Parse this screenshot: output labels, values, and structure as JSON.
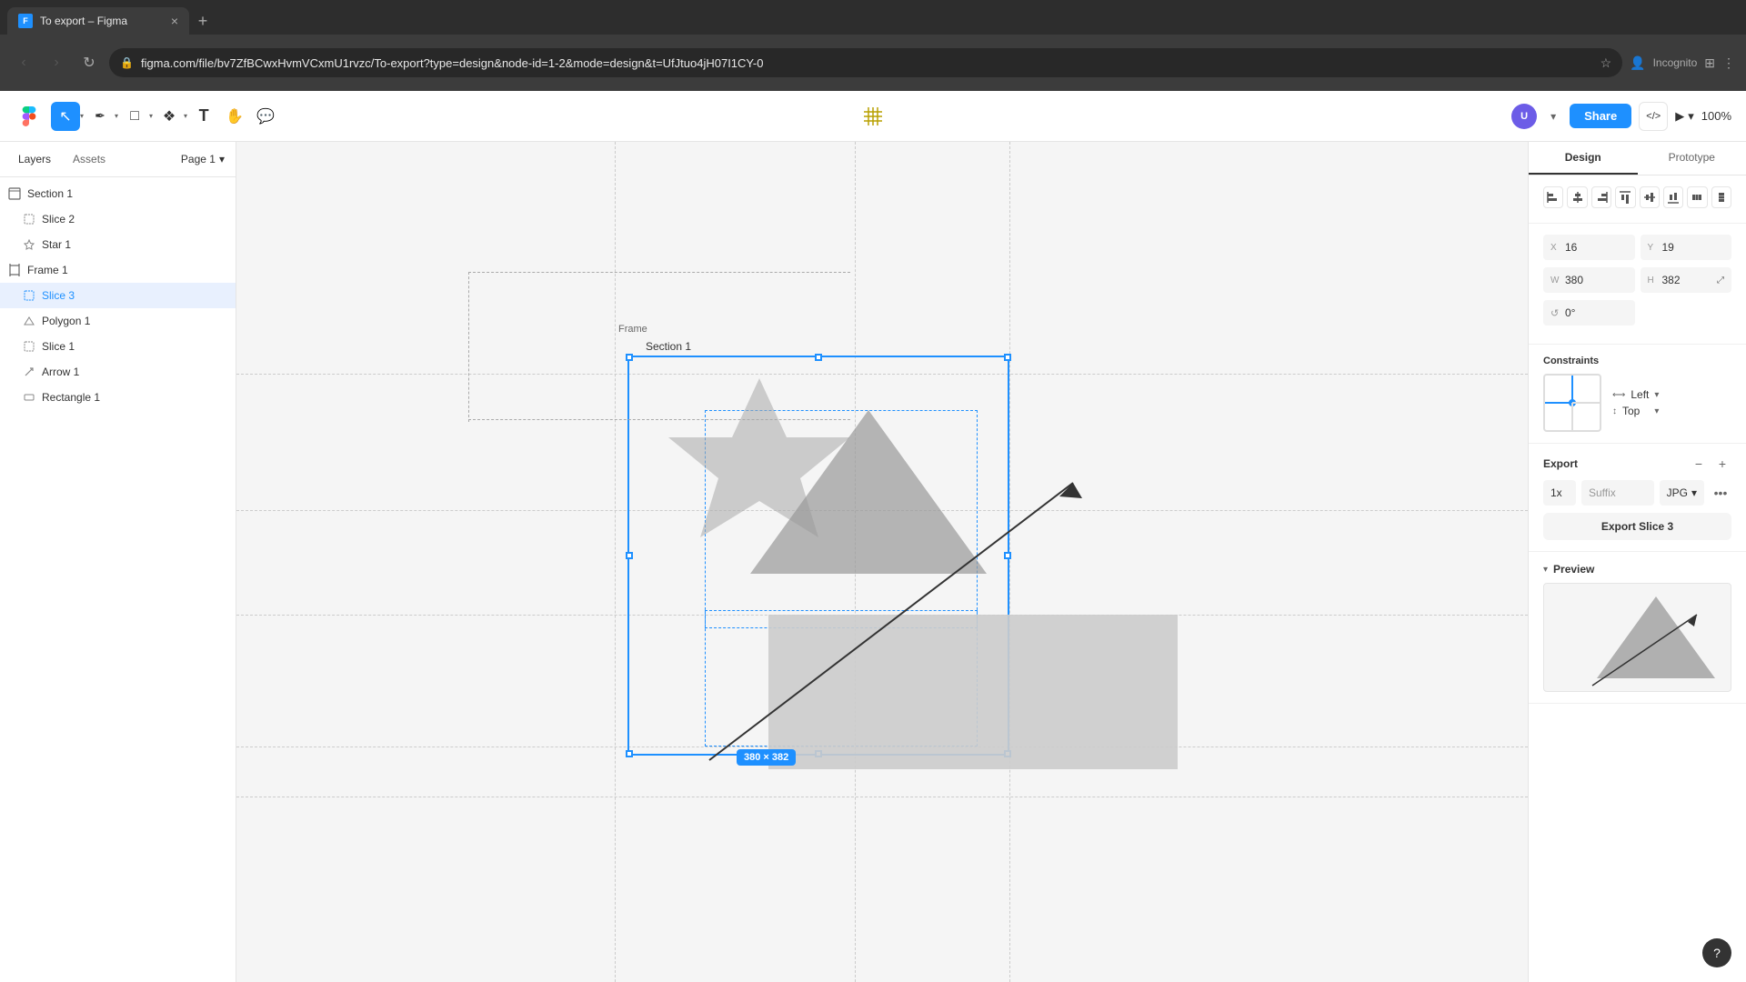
{
  "browser": {
    "tab_title": "To export – Figma",
    "tab_close": "×",
    "new_tab": "+",
    "url": "figma.com/file/bv7ZfBCwxHvmVCxmU1rvzc/To-export?type=design&node-id=1-2&mode=design&t=UfJtuo4jH07I1CY-0",
    "incognito_label": "Incognito",
    "nav_back": "←",
    "nav_forward": "→",
    "nav_reload": "↻"
  },
  "toolbar": {
    "title": "To export – Figma",
    "share_label": "Share",
    "zoom_level": "100%",
    "page_label": "Page 1"
  },
  "sidebar": {
    "tabs": {
      "layers": "Layers",
      "assets": "Assets"
    },
    "page": "Page 1",
    "layers": [
      {
        "id": "section1",
        "name": "Section 1",
        "icon": "⊞",
        "type": "section",
        "indent": 0
      },
      {
        "id": "slice2",
        "name": "Slice 2",
        "icon": "◻",
        "type": "slice",
        "indent": 1
      },
      {
        "id": "star1",
        "name": "Star 1",
        "icon": "✦",
        "type": "star",
        "indent": 1
      },
      {
        "id": "frame1",
        "name": "Frame 1",
        "icon": "⊞",
        "type": "frame",
        "indent": 0
      },
      {
        "id": "slice3",
        "name": "Slice 3",
        "icon": "◻",
        "type": "slice",
        "indent": 1,
        "selected": true
      },
      {
        "id": "polygon1",
        "name": "Polygon 1",
        "icon": "▲",
        "type": "polygon",
        "indent": 1
      },
      {
        "id": "slice1",
        "name": "Slice 1",
        "icon": "◻",
        "type": "slice",
        "indent": 1
      },
      {
        "id": "arrow1",
        "name": "Arrow 1",
        "icon": "⟋",
        "type": "arrow",
        "indent": 1
      },
      {
        "id": "rect1",
        "name": "Rectangle 1",
        "icon": "▭",
        "type": "rect",
        "indent": 1
      }
    ]
  },
  "canvas": {
    "frame_label": "Frame",
    "section_label": "Section 1",
    "dimension_badge": "380 × 382"
  },
  "right_panel": {
    "tabs": {
      "design": "Design",
      "prototype": "Prototype"
    },
    "design": {
      "x_label": "X",
      "x_value": "16",
      "y_label": "Y",
      "y_value": "19",
      "w_label": "W",
      "w_value": "380",
      "h_label": "H",
      "h_value": "382",
      "rotation_label": "°",
      "rotation_value": "0°",
      "constraints_title": "Constraints",
      "constraint_h": "Left",
      "constraint_v": "Top",
      "export_title": "Export",
      "export_scale": "1x",
      "export_suffix": "Suffix",
      "export_format": "JPG",
      "export_btn_label": "Export Slice 3",
      "preview_title": "Preview"
    }
  },
  "icons": {
    "figma": "F",
    "cursor": "↖",
    "pen": "✏",
    "rect": "□",
    "component": "❖",
    "hand": "✋",
    "comment": "💬",
    "move": "⊹",
    "grid": "⊞",
    "star": "✦",
    "polygon": "▲",
    "arrow": "→",
    "link": "⧉",
    "question": "?",
    "play": "▶",
    "chevron_down": "▾",
    "chevron_right": "›",
    "plus": "+",
    "minus": "−",
    "dots": "•••",
    "lock": "🔒",
    "resize": "⤢"
  },
  "colors": {
    "blue": "#1e90ff",
    "bg_canvas": "#f0f0f0",
    "selection_blue": "#1e90ff",
    "border": "#e5e5e5",
    "shape_gray": "#b8b8b8",
    "dark_shape": "#a0a0a0"
  }
}
